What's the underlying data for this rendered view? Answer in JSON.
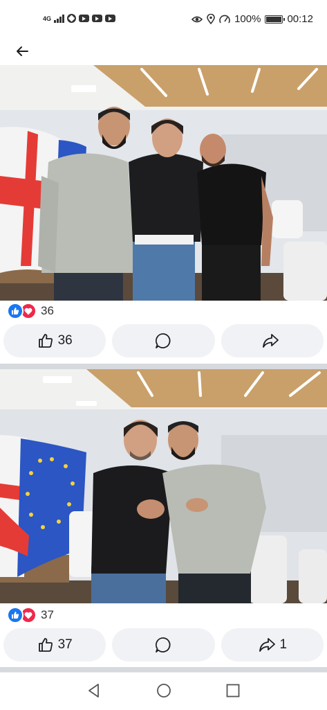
{
  "status_bar": {
    "network": "4G",
    "battery": "100%",
    "time": "00:12",
    "icons": [
      "signal-icon",
      "messenger-icon",
      "youtube-icon",
      "youtube-icon",
      "youtube-icon",
      "eye-icon",
      "location-icon",
      "speed-icon",
      "battery-icon"
    ]
  },
  "header": {
    "back_icon": "back-arrow-icon"
  },
  "posts": [
    {
      "reaction_count": "36",
      "like_count": "36",
      "share_count": "",
      "photo_description": "three men standing in a conference room in front of Georgian flags"
    },
    {
      "reaction_count": "37",
      "like_count": "37",
      "share_count": "1",
      "photo_description": "two men shaking hands in a conference room in front of Georgian and EU flags"
    }
  ],
  "nav": {
    "icons": [
      "back-triangle-icon",
      "home-circle-icon",
      "recents-square-icon"
    ]
  },
  "colors": {
    "like_blue": "#1877f2",
    "love_red": "#f0284a",
    "button_bg": "#f0f2f5",
    "divider": "#d6d9dd"
  }
}
